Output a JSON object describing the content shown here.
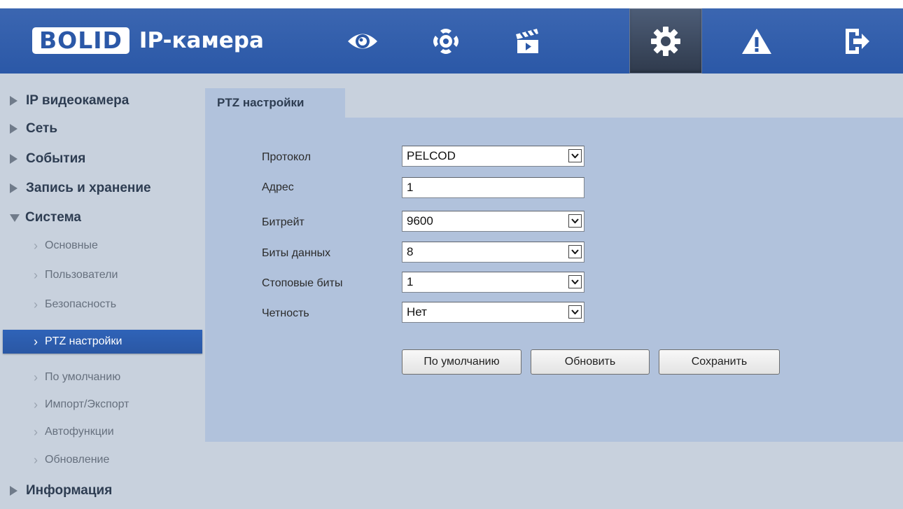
{
  "header": {
    "logo_text": "BOLID",
    "app_title": "IP-камера",
    "nav": [
      {
        "icon": "eye-icon",
        "name": "live-view"
      },
      {
        "icon": "ptz-control-icon",
        "name": "ptz-control"
      },
      {
        "icon": "clapperboard-icon",
        "name": "playback"
      },
      {
        "icon": "gear-icon",
        "name": "setup",
        "active": true
      },
      {
        "icon": "warning-icon",
        "name": "alarm"
      },
      {
        "icon": "logout-icon",
        "name": "logout"
      }
    ],
    "colors": {
      "bar": "#2b58a7",
      "active": "#3a475c"
    }
  },
  "sidebar": {
    "items": [
      {
        "label": "IP видеокамера",
        "level": 1,
        "expanded": false
      },
      {
        "label": "Сеть",
        "level": 1,
        "expanded": false
      },
      {
        "label": "События",
        "level": 1,
        "expanded": false
      },
      {
        "label": "Запись и хранение",
        "level": 1,
        "expanded": false
      },
      {
        "label": "Система",
        "level": 1,
        "expanded": true
      },
      {
        "label": "Основные",
        "level": 2
      },
      {
        "label": "Пользователи",
        "level": 2
      },
      {
        "label": "Безопасность",
        "level": 2
      },
      {
        "label": "PTZ настройки",
        "level": 2,
        "active": true
      },
      {
        "label": "По умолчанию",
        "level": 2
      },
      {
        "label": "Импорт/Экспорт",
        "level": 2
      },
      {
        "label": "Автофункции",
        "level": 2
      },
      {
        "label": "Обновление",
        "level": 2
      },
      {
        "label": "Информация",
        "level": 1,
        "expanded": false
      }
    ],
    "active_color": "#2b5aa9"
  },
  "content": {
    "tab_label": "PTZ настройки",
    "fields": {
      "protocol": {
        "label": "Протокол",
        "value": "PELCOD"
      },
      "address": {
        "label": "Адрес",
        "value": "1"
      },
      "baudrate": {
        "label": "Битрейт",
        "value": "9600"
      },
      "data_bits": {
        "label": "Биты данных",
        "value": "8"
      },
      "stop_bits": {
        "label": "Стоповые биты",
        "value": "1"
      },
      "parity": {
        "label": "Четность",
        "value": "Нет"
      }
    },
    "buttons": {
      "default": "По умолчанию",
      "refresh": "Обновить",
      "save": "Сохранить"
    },
    "panel_color": "#b1c2dc"
  }
}
